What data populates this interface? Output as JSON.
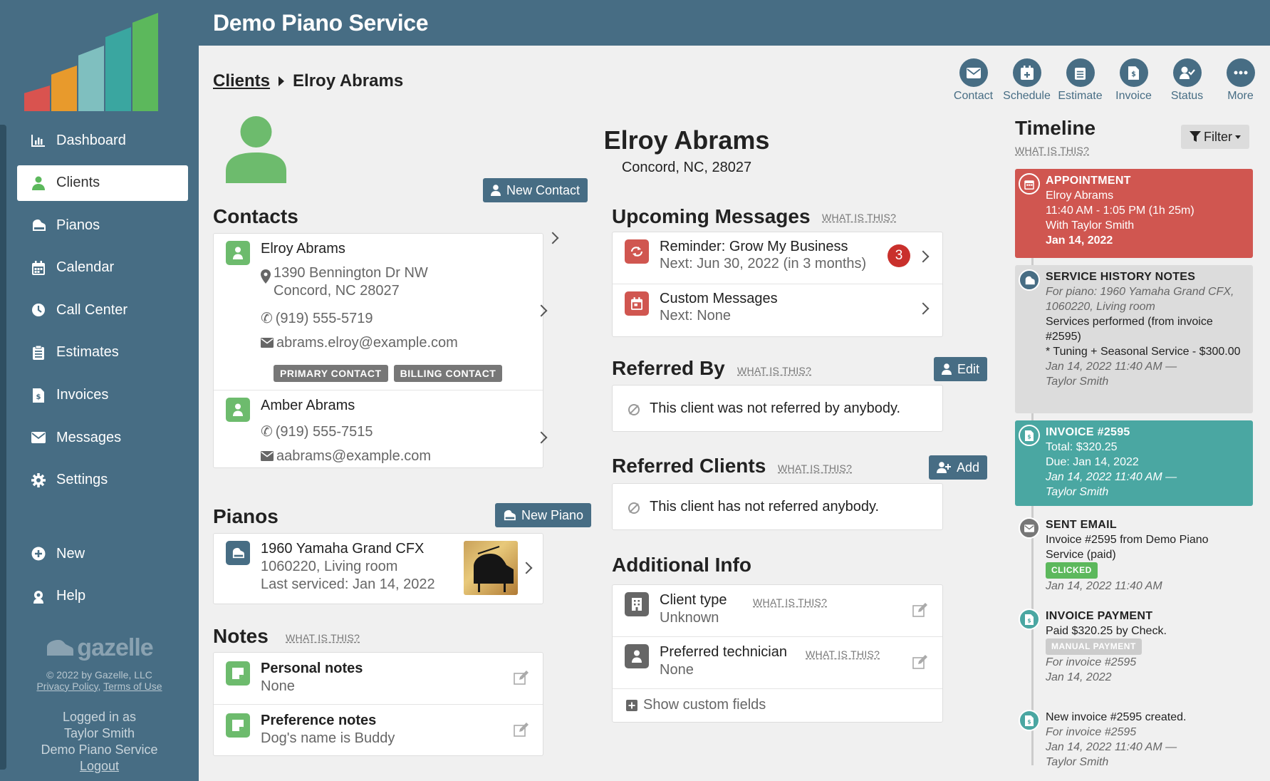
{
  "app": {
    "title": "Demo Piano Service"
  },
  "sidebar": {
    "items": [
      {
        "label": "Dashboard",
        "icon": "bar-chart-icon"
      },
      {
        "label": "Clients",
        "icon": "user-icon",
        "active": true
      },
      {
        "label": "Pianos",
        "icon": "piano-icon"
      },
      {
        "label": "Calendar",
        "icon": "calendar-icon"
      },
      {
        "label": "Call Center",
        "icon": "clock-icon"
      },
      {
        "label": "Estimates",
        "icon": "clipboard-icon"
      },
      {
        "label": "Invoices",
        "icon": "invoice-icon"
      },
      {
        "label": "Messages",
        "icon": "envelope-icon"
      },
      {
        "label": "Settings",
        "icon": "gear-icon"
      }
    ],
    "secondary": [
      {
        "label": "New",
        "icon": "plus-circle-icon"
      },
      {
        "label": "Help",
        "icon": "life-ring-icon"
      }
    ],
    "brand": "gazelle",
    "copyright": "© 2022 by Gazelle, LLC",
    "privacy": "Privacy Policy",
    "terms": "Terms of Use",
    "logged_in_as": "Logged in as",
    "user": "Taylor Smith",
    "company": "Demo Piano Service",
    "logout": "Logout",
    "logo_colors": [
      "#d9534f",
      "#e89a2c",
      "#7fbfbf",
      "#3aa6a0",
      "#5cb85c"
    ]
  },
  "breadcrumb": {
    "root": "Clients",
    "current": "Elroy Abrams"
  },
  "actions": [
    {
      "label": "Contact",
      "icon": "envelope-icon"
    },
    {
      "label": "Schedule",
      "icon": "calendar-plus-icon"
    },
    {
      "label": "Estimate",
      "icon": "clipboard-icon"
    },
    {
      "label": "Invoice",
      "icon": "invoice-icon"
    },
    {
      "label": "Status",
      "icon": "user-check-icon"
    },
    {
      "label": "More",
      "icon": "ellipsis-icon"
    }
  ],
  "client": {
    "name": "Elroy Abrams",
    "location": "Concord, NC, 28027"
  },
  "contacts": {
    "title": "Contacts",
    "new_button": "New Contact",
    "items": [
      {
        "name": "Elroy Abrams",
        "address1": "1390 Bennington Dr NW",
        "address2": "Concord, NC 28027",
        "phone": "(919) 555-5719",
        "email": "abrams.elroy@example.com",
        "badges": [
          "PRIMARY CONTACT",
          "BILLING CONTACT"
        ]
      },
      {
        "name": "Amber Abrams",
        "phone": "(919) 555-7515",
        "email": "aabrams@example.com"
      }
    ]
  },
  "pianos": {
    "title": "Pianos",
    "new_button": "New Piano",
    "items": [
      {
        "name": "1960 Yamaha Grand CFX",
        "detail": "1060220, Living room",
        "serviced": "Last serviced: Jan 14, 2022"
      }
    ]
  },
  "notes": {
    "title": "Notes",
    "what": "WHAT IS THIS?",
    "items": [
      {
        "title": "Personal notes",
        "value": "None"
      },
      {
        "title": "Preference notes",
        "value": "Dog's name is Buddy"
      }
    ]
  },
  "upcoming": {
    "title": "Upcoming Messages",
    "what": "WHAT IS THIS?",
    "items": [
      {
        "title": "Reminder: Grow My Business",
        "next": "Next: Jun 30, 2022 (in 3 months)",
        "count": "3"
      },
      {
        "title": "Custom Messages",
        "next": "Next: None"
      }
    ]
  },
  "referred_by": {
    "title": "Referred By",
    "what": "WHAT IS THIS?",
    "button": "Edit",
    "text": "This client was not referred by anybody."
  },
  "referred_clients": {
    "title": "Referred Clients",
    "what": "WHAT IS THIS?",
    "button": "Add",
    "text": "This client has not referred anybody."
  },
  "additional": {
    "title": "Additional Info",
    "items": [
      {
        "label": "Client type",
        "what": "WHAT IS THIS?",
        "value": "Unknown"
      },
      {
        "label": "Preferred technician",
        "what": "WHAT IS THIS?",
        "value": "None"
      }
    ],
    "show_custom": "Show custom fields"
  },
  "timeline": {
    "title": "Timeline",
    "what": "WHAT IS THIS?",
    "filter": "Filter",
    "appointment": {
      "title": "APPOINTMENT",
      "l1": "Elroy Abrams",
      "l2": "11:40 AM - 1:05 PM (1h 25m)",
      "l3": "With Taylor Smith",
      "l4": "Jan 14, 2022"
    },
    "service": {
      "title": "SERVICE HISTORY NOTES",
      "l1": "For piano: 1960 Yamaha Grand CFX, 1060220, Living room",
      "l2": "Services performed (from invoice #2595)",
      "l3": "* Tuning + Seasonal Service - $300.00",
      "l4": "Jan 14, 2022 11:40 AM —",
      "l5": "Taylor Smith"
    },
    "invoice": {
      "title": "INVOICE #2595",
      "l1": "Total: $320.25",
      "l2": "Due: Jan 14, 2022",
      "l3": "Jan 14, 2022 11:40 AM —",
      "l4": "Taylor Smith"
    },
    "email": {
      "title": "SENT EMAIL",
      "l1": "Invoice #2595 from Demo Piano Service (paid)",
      "pill": "CLICKED",
      "l2": "Jan 14, 2022 11:40 AM"
    },
    "payment": {
      "title": "INVOICE PAYMENT",
      "l1": "Paid $320.25 by Check.",
      "pill": "MANUAL PAYMENT",
      "l2": "For invoice #2595",
      "l3": "Jan 14, 2022"
    },
    "created": {
      "l1": "New invoice #2595 created.",
      "l2": "For invoice #2595",
      "l3": "Jan 14, 2022 11:40 AM —",
      "l4": "Taylor Smith"
    }
  },
  "colors": {
    "primary": "#476d84",
    "green": "#5cb85c",
    "red": "#d05650",
    "teal": "#4aa7a2",
    "gray": "#dcdcdc"
  }
}
